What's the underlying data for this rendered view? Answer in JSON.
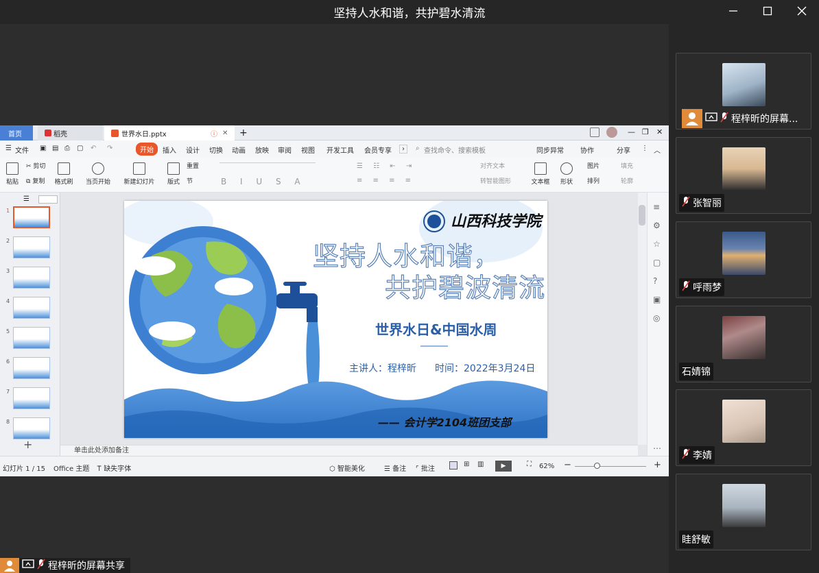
{
  "meeting": {
    "title": "坚持人水和谐，共护碧水清流"
  },
  "participants": [
    {
      "name": "程梓昕的屏幕...",
      "avatar_colors": [
        "#c9d7e6",
        "#3a4a5a"
      ]
    },
    {
      "name": "张智丽",
      "avatar_colors": [
        "#e2c7a8",
        "#2b2b2b"
      ]
    },
    {
      "name": "呼雨梦",
      "avatar_colors": [
        "#4a6a9a",
        "#e0b070"
      ]
    },
    {
      "name": "石婧锦",
      "avatar_colors": [
        "#6a3a3a",
        "#c0a0a0"
      ]
    },
    {
      "name": "李婧",
      "avatar_colors": [
        "#e8d8cc",
        "#b0a090"
      ]
    },
    {
      "name": "眭舒敏",
      "avatar_colors": [
        "#c0c8d0",
        "#3a3a3a"
      ]
    }
  ],
  "share": {
    "label": "程梓昕的屏幕共享"
  },
  "wps": {
    "tabs": [
      "首页",
      "稻壳",
      "世界水日.pptx"
    ],
    "menu": [
      "文件",
      "开始",
      "插入",
      "设计",
      "切换",
      "动画",
      "放映",
      "审阅",
      "视图",
      "开发工具",
      "会员专享"
    ],
    "search_placeholder": "查找命令、搜索模板",
    "menu_right": [
      "同步异常",
      "协作",
      "分享"
    ],
    "ribbon": [
      "粘贴",
      "剪切",
      "复制",
      "格式刷",
      "当页开始",
      "新建幻灯片",
      "版式",
      "节",
      "重置",
      "文本框",
      "形状",
      "图片",
      "排列",
      "填充",
      "轮廓",
      "对齐文本",
      "转智能图形"
    ],
    "slides_count": 8,
    "notes_placeholder": "单击此处添加备注",
    "status": {
      "slide_counter": "幻灯片 1 / 15",
      "theme": "Office 主题",
      "missing_font": "缺失字体",
      "beautify": "智能美化",
      "notes": "备注",
      "comments": "批注",
      "zoom": "62%"
    }
  },
  "slide": {
    "logo_text": "山西科技学院",
    "title_line1": "坚持人水和谐，",
    "title_line2": "共护碧波清流",
    "subtitle": "世界水日&中国水周",
    "presenter": "主讲人：程梓昕",
    "time": "时间：2022年3月24日",
    "footer": "—— 会计学2104班团支部"
  },
  "colors": {
    "accent": "#e8562a",
    "blue": "#2a6fc4",
    "deep": "#1e4f99",
    "wave": "#4a90d9"
  }
}
